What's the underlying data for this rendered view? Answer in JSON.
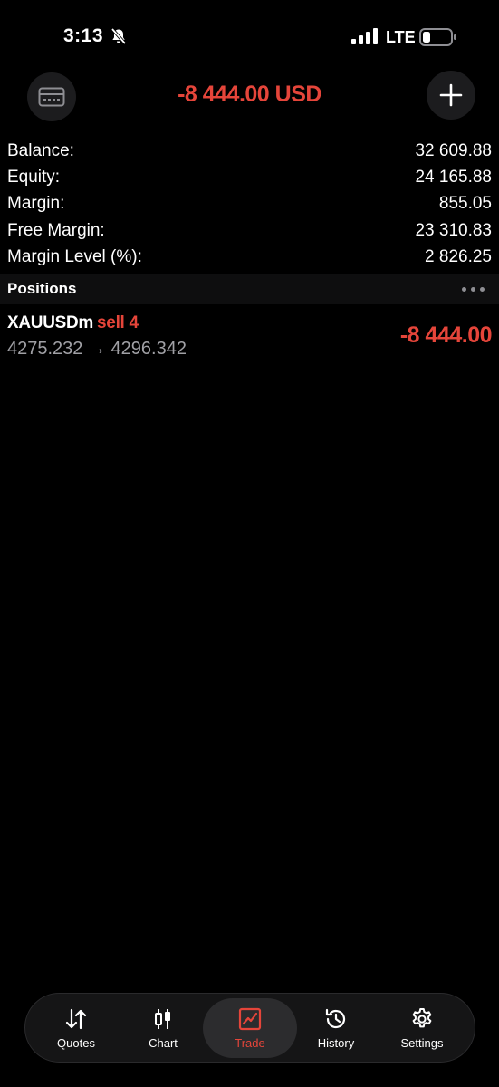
{
  "status_bar": {
    "time": "3:13",
    "network": "LTE"
  },
  "header": {
    "total_profit": "-8 444.00 USD",
    "left_icon": "wallet-icon",
    "right_icon": "plus-icon"
  },
  "summary": [
    {
      "label": "Balance:",
      "value": "32 609.88"
    },
    {
      "label": "Equity:",
      "value": "24 165.88"
    },
    {
      "label": "Margin:",
      "value": "855.05"
    },
    {
      "label": "Free Margin:",
      "value": "23 310.83"
    },
    {
      "label": "Margin Level (%):",
      "value": "2 826.25"
    }
  ],
  "positions": {
    "title": "Positions",
    "items": [
      {
        "symbol": "XAUUSDm",
        "side": "sell 4",
        "prices": "4275.232 → 4296.342",
        "profit": "-8 444.00"
      }
    ]
  },
  "tabs": [
    {
      "label": "Quotes",
      "icon": "quotes-icon"
    },
    {
      "label": "Chart",
      "icon": "candlestick-icon"
    },
    {
      "label": "Trade",
      "icon": "trade-icon"
    },
    {
      "label": "History",
      "icon": "history-icon"
    },
    {
      "label": "Settings",
      "icon": "gear-icon"
    }
  ],
  "colors": {
    "accent": "#e5453a",
    "background": "#000000",
    "muted": "#a0a0a5"
  }
}
